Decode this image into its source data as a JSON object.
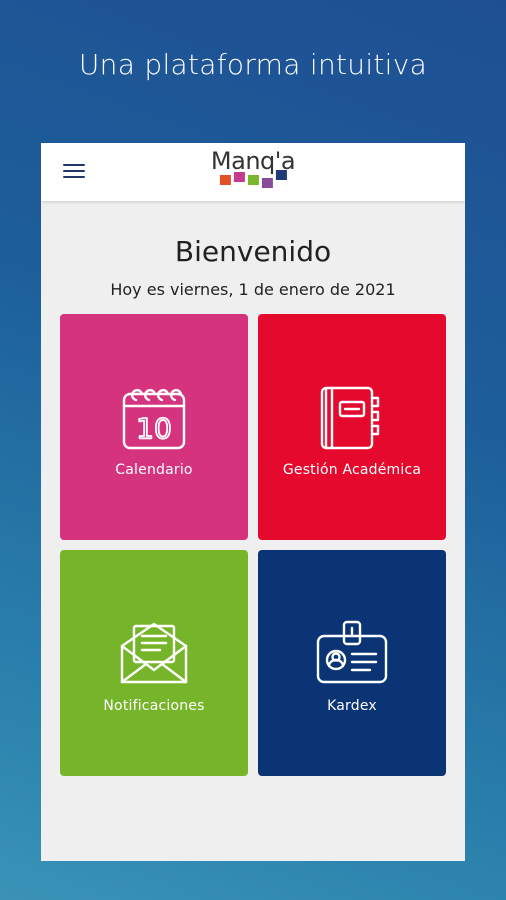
{
  "promo": {
    "headline": "Una plataforma intuitiva"
  },
  "app": {
    "logo_text": "Manq'a",
    "logo_colors": [
      "#e2502a",
      "#c43a8c",
      "#79b82a",
      "#8a4a9a",
      "#1f3c78"
    ],
    "welcome": "Bienvenido",
    "date_text": "Hoy es viernes, 1 de enero de 2021"
  },
  "tiles": [
    {
      "label": "Calendario",
      "color": "#d6337f",
      "icon": "calendar-icon"
    },
    {
      "label": "Gestión Académica",
      "color": "#e5092d",
      "icon": "book-icon"
    },
    {
      "label": "Notificaciones",
      "color": "#76b52a",
      "icon": "envelope-icon"
    },
    {
      "label": "Kardex",
      "color": "#0b3474",
      "icon": "id-card-icon"
    }
  ],
  "calendar_icon_number": "10"
}
